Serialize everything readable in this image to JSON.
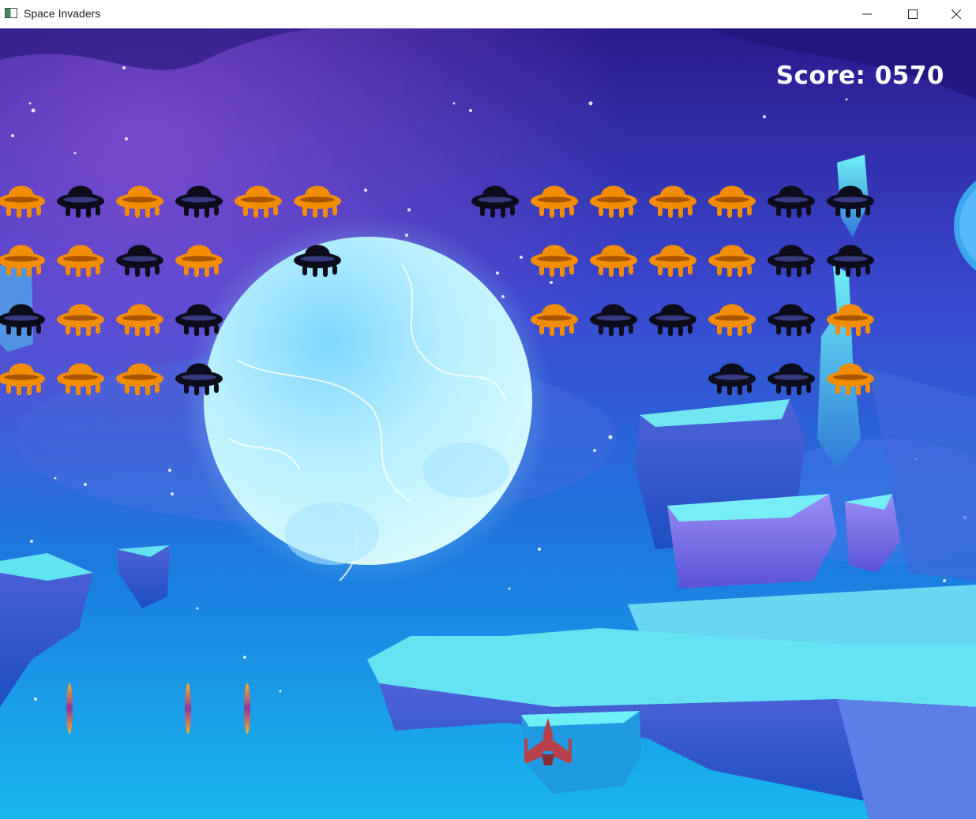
{
  "window": {
    "title": "Space Invaders",
    "controls": [
      "minimize",
      "maximize",
      "close"
    ]
  },
  "hud": {
    "score_label": "Score: 0570"
  },
  "colors": {
    "invader_orange": "#f28c00",
    "invader_black": "#0c0c1a",
    "player_ship": "#b8404a",
    "score_text": "#ffffff"
  },
  "invaders": {
    "rows": [
      [
        "orange",
        "black",
        "orange",
        "black",
        "orange",
        "orange",
        "empty",
        "empty",
        "black",
        "orange",
        "orange",
        "orange",
        "orange",
        "black",
        "black"
      ],
      [
        "orange",
        "orange",
        "black",
        "orange",
        "empty",
        "black",
        "empty",
        "empty",
        "empty",
        "orange",
        "orange",
        "orange",
        "orange",
        "black",
        "black"
      ],
      [
        "black",
        "orange",
        "orange",
        "black",
        "empty",
        "empty",
        "empty",
        "empty",
        "empty",
        "orange",
        "black",
        "black",
        "orange",
        "black",
        "orange"
      ],
      [
        "orange",
        "orange",
        "orange",
        "black",
        "empty",
        "empty",
        "empty",
        "empty",
        "empty",
        "empty",
        "empty",
        "empty",
        "black",
        "black",
        "orange"
      ]
    ]
  },
  "player_bullets": 3,
  "player": {
    "icon": "player-ship-icon"
  }
}
